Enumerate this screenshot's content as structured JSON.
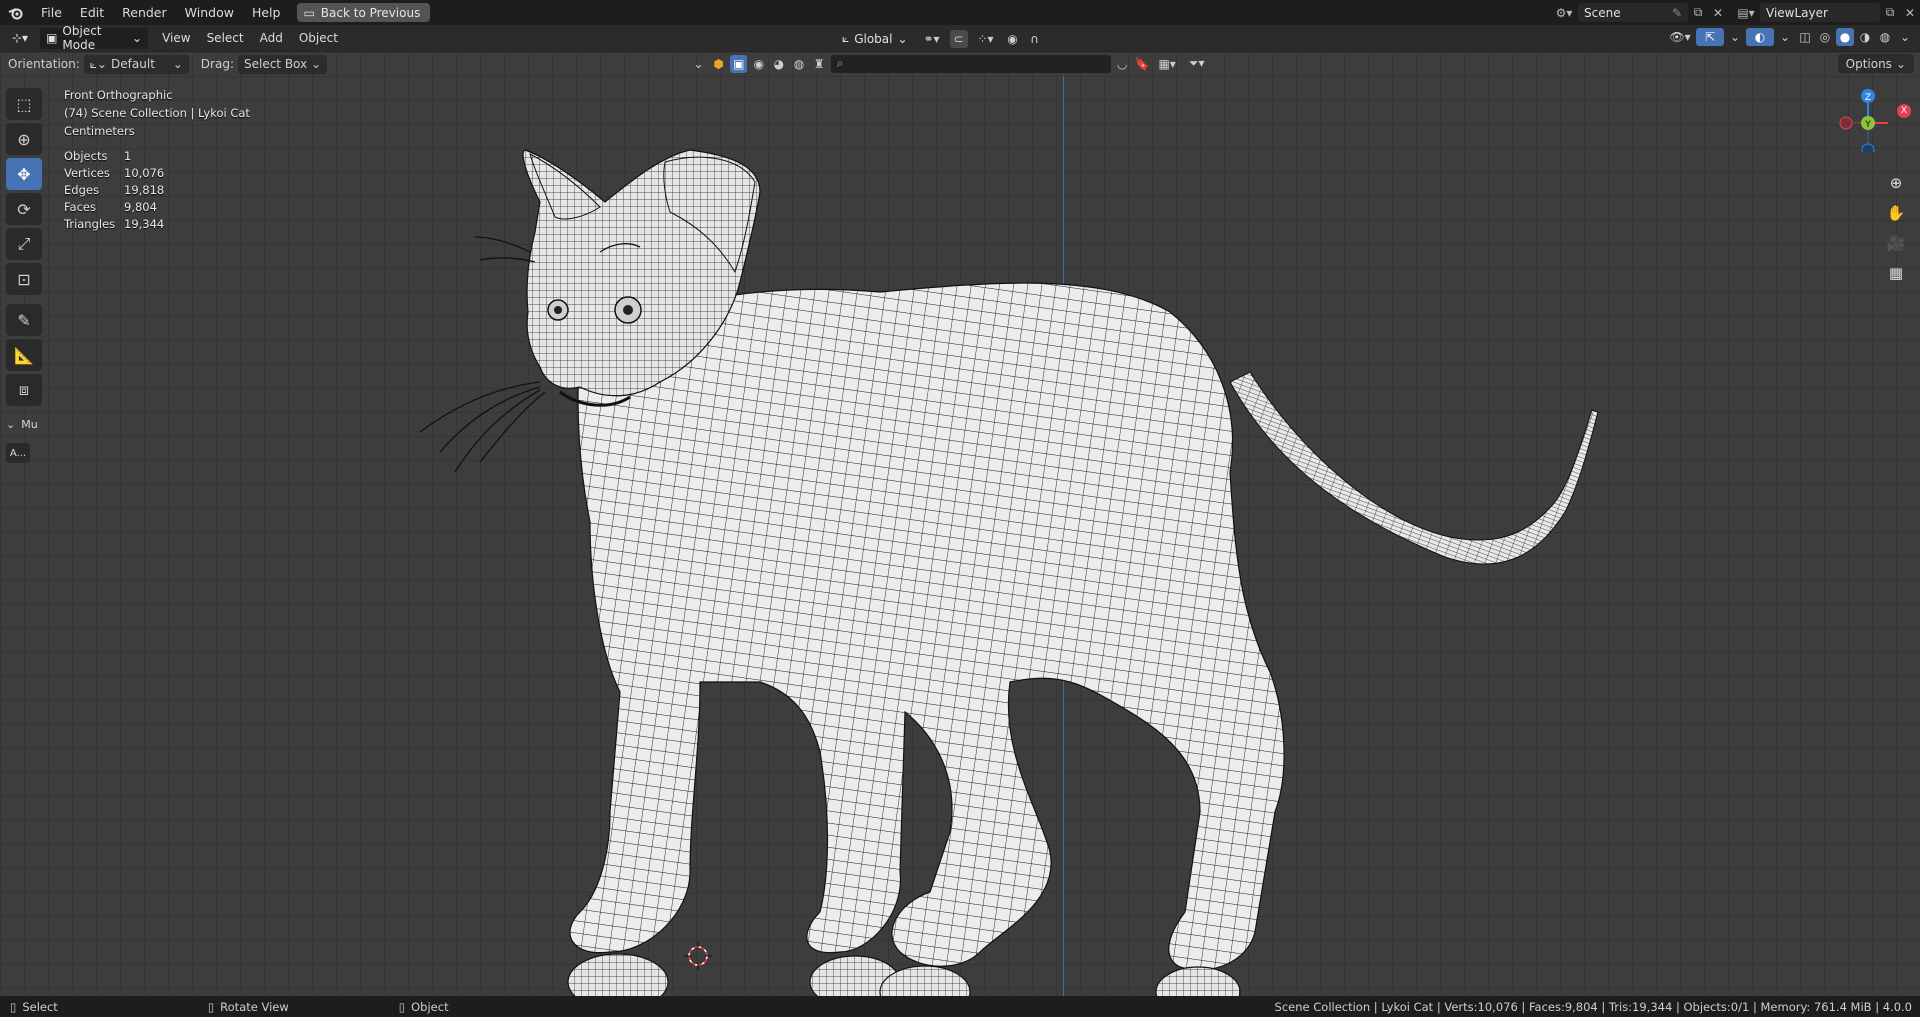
{
  "topbar": {
    "menus": [
      "File",
      "Edit",
      "Render",
      "Window",
      "Help"
    ],
    "back_label": "Back to Previous",
    "scene_name": "Scene",
    "view_layer": "ViewLayer"
  },
  "header": {
    "mode": "Object Mode",
    "menus": [
      "View",
      "Select",
      "Add",
      "Object"
    ],
    "transform_orientation": "Global"
  },
  "tool_settings": {
    "orientation_label": "Orientation:",
    "orientation_value": "Default",
    "drag_label": "Drag:",
    "drag_value": "Select Box",
    "options_label": "Options"
  },
  "overlay": {
    "view_name": "Front Orthographic",
    "collection": "(74) Scene Collection | Lykoi Cat",
    "units": "Centimeters",
    "stats": [
      {
        "label": "Objects",
        "value": "1"
      },
      {
        "label": "Vertices",
        "value": "10,076"
      },
      {
        "label": "Edges",
        "value": "19,818"
      },
      {
        "label": "Faces",
        "value": "9,804"
      },
      {
        "label": "Triangles",
        "value": "19,344"
      }
    ]
  },
  "toolbar": {
    "panel_label": "Mu",
    "panel_button": "A..."
  },
  "gizmo": {
    "z": "Z",
    "y": "Y",
    "x": "X",
    "colors": {
      "x": "#e4414d",
      "y": "#8ac33e",
      "z": "#2f83e3"
    }
  },
  "statusbar": {
    "select": "Select",
    "rotate": "Rotate View",
    "object": "Object",
    "info": "Scene Collection | Lykoi Cat | Verts:10,076 | Faces:9,804 | Tris:19,344 | Objects:0/1 | Memory: 761.4 MiB | 4.0.0"
  },
  "colors": {
    "accent": "#4772b3",
    "axis_line": "#3e6ea8"
  }
}
